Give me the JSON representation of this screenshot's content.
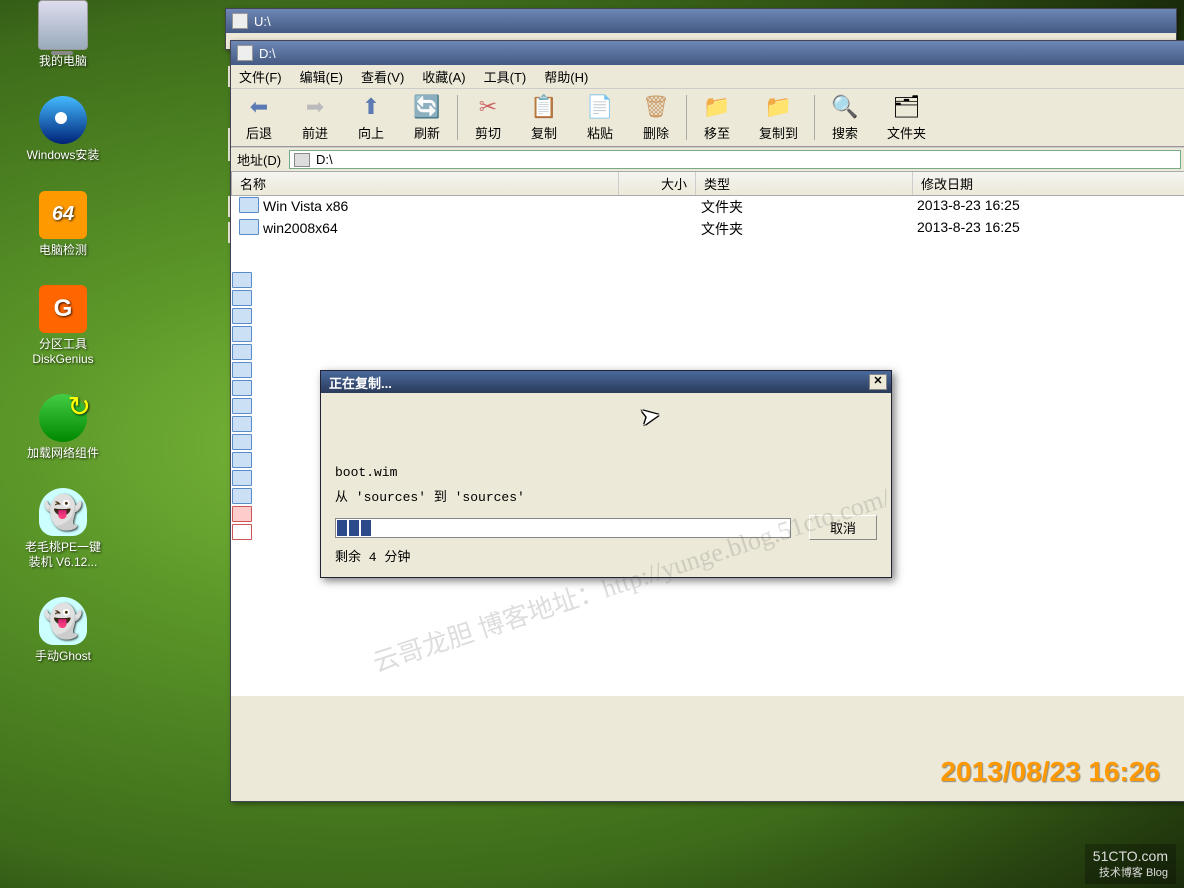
{
  "desktop": {
    "icons": [
      {
        "name": "my-computer",
        "label": "我的电脑"
      },
      {
        "name": "windows-install",
        "label": "Windows安装"
      },
      {
        "name": "pc-check",
        "label": "电脑检测",
        "badge": "64"
      },
      {
        "name": "diskgenius",
        "label": "分区工具\nDiskGenius",
        "badge": "G"
      },
      {
        "name": "net-load",
        "label": "加载网络组件"
      },
      {
        "name": "pe-install",
        "label": "老毛桃PE一键\n装机 V6.12..."
      },
      {
        "name": "manual-ghost",
        "label": "手动Ghost"
      }
    ]
  },
  "window_u": {
    "title": "U:\\"
  },
  "window_d": {
    "title": "D:\\",
    "menu": {
      "file": "文件(F)",
      "edit": "编辑(E)",
      "view": "查看(V)",
      "fav": "收藏(A)",
      "tools": "工具(T)",
      "help": "帮助(H)"
    },
    "toolbar": {
      "back": "后退",
      "fwd": "前进",
      "up": "向上",
      "refresh": "刷新",
      "cut": "剪切",
      "copy": "复制",
      "paste": "粘贴",
      "delete": "删除",
      "moveto": "移至",
      "copyto": "复制到",
      "search": "搜索",
      "folders": "文件夹"
    },
    "addr_label": "地址(D)",
    "addr_value": "D:\\",
    "columns": {
      "name": "名称",
      "size": "大小",
      "type": "类型",
      "date": "修改日期"
    },
    "rows": [
      {
        "name": "Win Vista x86",
        "type": "文件夹",
        "date": "2013-8-23 16:25"
      },
      {
        "name": "win2008x64",
        "type": "文件夹",
        "date": "2013-8-23 16:25"
      }
    ]
  },
  "bg_stubs": {
    "a": "文",
    "b": "后",
    "c": "地",
    "d": "名"
  },
  "copy_dialog": {
    "title": "正在复制...",
    "filename": "boot.wim",
    "path_line": "从 'sources' 到 'sources'",
    "remaining": "剩余 4 分钟",
    "cancel": "取消"
  },
  "watermark": "云哥龙胆 博客地址：http://yunge.blog.51cto.com/",
  "timestamp": "2013/08/23 16:26",
  "sitelogo": {
    "big": "51CTO.com",
    "small": "技术博客   Blog"
  }
}
